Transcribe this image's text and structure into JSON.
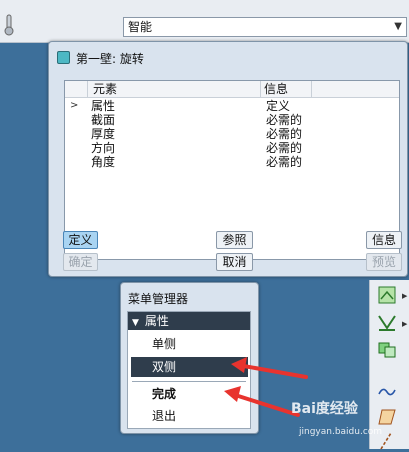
{
  "toolbar": {
    "selection_filter": "智能"
  },
  "dialog": {
    "title": "第一壁: 旋转",
    "columns": [
      "元素",
      "信息"
    ],
    "rows": [
      {
        "element": "属性",
        "info": "定义"
      },
      {
        "element": "截面",
        "info": "必需的"
      },
      {
        "element": "厚度",
        "info": "必需的"
      },
      {
        "element": "方向",
        "info": "必需的"
      },
      {
        "element": "角度",
        "info": "必需的"
      }
    ],
    "buttons": {
      "define": "定义",
      "reference": "参照",
      "info": "信息",
      "ok": "确定",
      "cancel": "取消",
      "preview": "预览"
    }
  },
  "menu_manager": {
    "title": "菜单管理器",
    "section": "属性",
    "items": [
      "单侧",
      "双侧",
      "完成",
      "退出"
    ],
    "selected": "双侧"
  },
  "watermark": {
    "brand": "Bai度经验",
    "url": "jingyan.baidu.com"
  },
  "colors": {
    "annotation_arrow": "#e8332e",
    "selected_bg": "#2f3d4c",
    "active_button": "#a9d4f2"
  }
}
